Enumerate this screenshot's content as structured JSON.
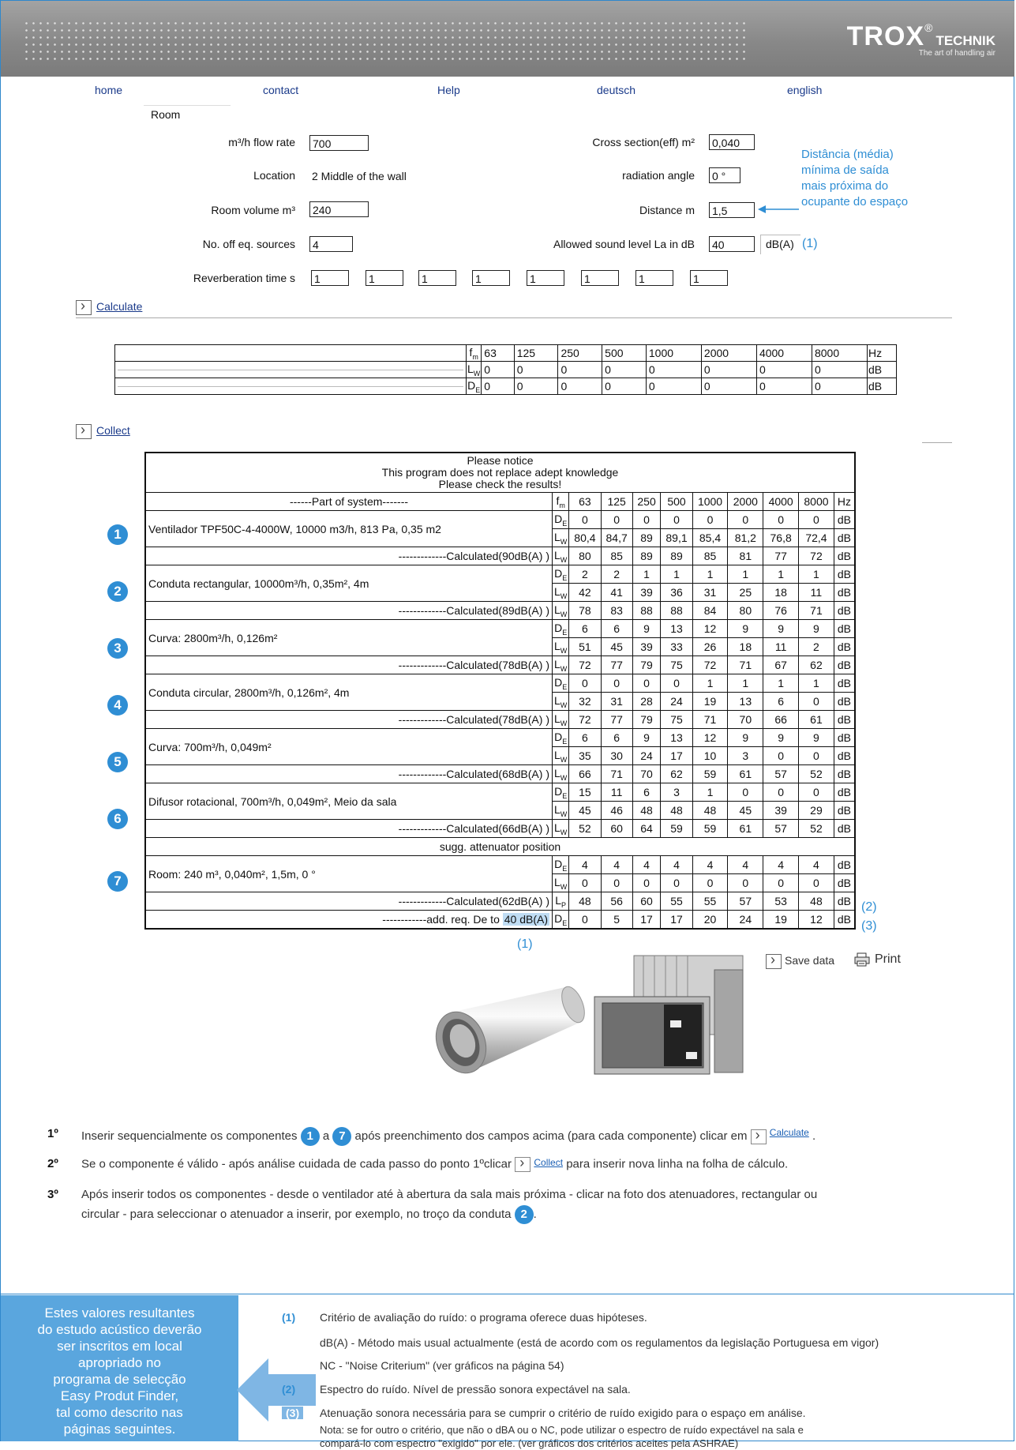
{
  "brand": {
    "logo_text": "TROX",
    "logo_suffix": "TECHNIK",
    "tagline": "The art of handling air"
  },
  "nav": [
    "home",
    "contact",
    "Help",
    "deutsch",
    "english"
  ],
  "room_label": "Room",
  "form": {
    "flow_label": "m³/h flow rate",
    "flow_value": "700",
    "location_label": "Location",
    "location_value": "2 Middle of the wall",
    "volume_label": "Room volume m³",
    "volume_value": "240",
    "sources_label": "No. off eq. sources",
    "sources_value": "4",
    "reverb_label": "Reverberation time s",
    "reverb_values": [
      "1",
      "1",
      "1",
      "1",
      "1",
      "1",
      "1",
      "1"
    ],
    "cross_label": "Cross section(eff) m²",
    "cross_value": "0,040",
    "angle_label": "radiation angle",
    "angle_value": "0 °",
    "distance_label": "Distance m",
    "distance_value": "1,5",
    "allowed_label": "Allowed sound level La in dB",
    "allowed_value": "40",
    "allowed_unit": "dB(A)",
    "allowed_ref": "(1)"
  },
  "distance_note": [
    "Distância (média)",
    "mínima de saída",
    "mais próxima do",
    "ocupante do espaço"
  ],
  "calculate_label": "Calculate",
  "collect_label": "Collect",
  "top_table": {
    "freqs": [
      "63",
      "125",
      "250",
      "500",
      "1000",
      "2000",
      "4000",
      "8000"
    ],
    "hz": "Hz",
    "fm": "fm",
    "lw": "LW",
    "de": "DE",
    "lw_values": [
      "0",
      "0",
      "0",
      "0",
      "0",
      "0",
      "0",
      "0"
    ],
    "de_values": [
      "0",
      "0",
      "0",
      "0",
      "0",
      "0",
      "0",
      "0"
    ],
    "unit": "dB"
  },
  "main_table": {
    "notice": [
      "Please notice",
      "This program does not replace adept knowledge",
      "Please check the results!"
    ],
    "part_header": "------Part of system-------",
    "fm": "fm",
    "freqs": [
      "63",
      "125",
      "250",
      "500",
      "1000",
      "2000",
      "4000",
      "8000"
    ],
    "hz": "Hz",
    "components": [
      {
        "num": "1",
        "name": "Ventilador TPF50C-4-4000W, 10000 m3/h, 813 Pa, 0,35 m2",
        "de": [
          "0",
          "0",
          "0",
          "0",
          "0",
          "0",
          "0",
          "0"
        ],
        "lw": [
          "80,4",
          "84,7",
          "89",
          "89,1",
          "85,4",
          "81,2",
          "76,8",
          "72,4"
        ],
        "calc": "-------------Calculated(90dB(A) )",
        "calc_vals": [
          "80",
          "85",
          "89",
          "89",
          "85",
          "81",
          "77",
          "72"
        ]
      },
      {
        "num": "2",
        "name": "Conduta rectangular, 10000m³/h, 0,35m², 4m",
        "de": [
          "2",
          "2",
          "1",
          "1",
          "1",
          "1",
          "1",
          "1"
        ],
        "lw": [
          "42",
          "41",
          "39",
          "36",
          "31",
          "25",
          "18",
          "11"
        ],
        "calc": "-------------Calculated(89dB(A) )",
        "calc_vals": [
          "78",
          "83",
          "88",
          "88",
          "84",
          "80",
          "76",
          "71"
        ]
      },
      {
        "num": "3",
        "name": "Curva: 2800m³/h, 0,126m²",
        "de": [
          "6",
          "6",
          "9",
          "13",
          "12",
          "9",
          "9",
          "9"
        ],
        "lw": [
          "51",
          "45",
          "39",
          "33",
          "26",
          "18",
          "11",
          "2"
        ],
        "calc": "-------------Calculated(78dB(A) )",
        "calc_vals": [
          "72",
          "77",
          "79",
          "75",
          "72",
          "71",
          "67",
          "62"
        ]
      },
      {
        "num": "4",
        "name": "Conduta circular, 2800m³/h, 0,126m², 4m",
        "de": [
          "0",
          "0",
          "0",
          "0",
          "1",
          "1",
          "1",
          "1"
        ],
        "lw": [
          "32",
          "31",
          "28",
          "24",
          "19",
          "13",
          "6",
          "0"
        ],
        "calc": "-------------Calculated(78dB(A) )",
        "calc_vals": [
          "72",
          "77",
          "79",
          "75",
          "71",
          "70",
          "66",
          "61"
        ]
      },
      {
        "num": "5",
        "name": "Curva: 700m³/h, 0,049m²",
        "de": [
          "6",
          "6",
          "9",
          "13",
          "12",
          "9",
          "9",
          "9"
        ],
        "lw": [
          "35",
          "30",
          "24",
          "17",
          "10",
          "3",
          "0",
          "0"
        ],
        "calc": "-------------Calculated(68dB(A) )",
        "calc_vals": [
          "66",
          "71",
          "70",
          "62",
          "59",
          "61",
          "57",
          "52"
        ]
      },
      {
        "num": "6",
        "name": "Difusor rotacional, 700m³/h, 0,049m², Meio da sala",
        "de": [
          "15",
          "11",
          "6",
          "3",
          "1",
          "0",
          "0",
          "0"
        ],
        "lw": [
          "45",
          "46",
          "48",
          "48",
          "48",
          "45",
          "39",
          "29"
        ],
        "calc": "-------------Calculated(66dB(A) )",
        "calc_vals": [
          "52",
          "60",
          "64",
          "59",
          "59",
          "61",
          "57",
          "52"
        ]
      }
    ],
    "sugg": "sugg. attenuator position",
    "room": {
      "num": "7",
      "name": "Room: 240 m³, 0,040m², 1,5m, 0 °",
      "de": [
        "4",
        "4",
        "4",
        "4",
        "4",
        "4",
        "4",
        "4"
      ],
      "lw": [
        "0",
        "0",
        "0",
        "0",
        "0",
        "0",
        "0",
        "0"
      ]
    },
    "final_calc": "-------------Calculated(62dB(A) )",
    "lp": "LP",
    "final_vals": [
      "48",
      "56",
      "60",
      "55",
      "55",
      "57",
      "53",
      "48"
    ],
    "final_ref": "(2)",
    "add_label": "------------add. req. De to",
    "add_hl": "40 dB(A)",
    "add_vals": [
      "0",
      "5",
      "17",
      "17",
      "20",
      "24",
      "19",
      "12"
    ],
    "add_ref": "(3)",
    "below_ref": "(1)",
    "unit": "dB",
    "de_sym": "DE",
    "lw_sym": "LW"
  },
  "save_label": "Save data",
  "print_label": "Print",
  "steps": [
    {
      "n": "1º",
      "a": "Inserir sequencialmente os componentes",
      "b": "a",
      "c": "após preenchimento dos campos acima (para cada componente) clicar em",
      "d": "Calculate",
      "e": "."
    },
    {
      "n": "2º",
      "a": "Se o componente é válido  - após análise cuidada de cada passo do ponto 1ºclicar",
      "d": "Collect",
      "e": "para inserir nova linha na folha de cálculo."
    },
    {
      "n": "3º",
      "a": "Após inserir todos os componentes - desde o ventilador até à abertura da sala mais próxima - clicar na foto dos atenuadores, rectangular ou",
      "b": "circular - para seleccionar o atenuador a inserir, por exemplo, no troço da conduta",
      "e": "."
    }
  ],
  "blue_box": [
    "Estes valores resultantes",
    "do estudo acústico deverão",
    "ser inscritos em local",
    "apropriado no",
    "programa de selecção",
    "Easy Produt Finder,",
    "tal como descrito nas",
    "páginas seguintes."
  ],
  "notes": [
    {
      "k": "(1)",
      "t": "Critério de avaliação do ruído: o programa oferece duas hipóteses."
    },
    {
      "k": "",
      "t": "dB(A) - Método mais usual actualmente (está de acordo com os regulamentos da legislação Portuguesa em vigor)"
    },
    {
      "k": "",
      "t": "NC - \"Noise Criterium\" (ver gráficos na página 54)"
    },
    {
      "k": "(2)",
      "t": "Espectro do ruído. Nível de pressão sonora expectável na sala."
    },
    {
      "k": "(3)",
      "t": "Atenuação sonora necessária para se cumprir o critério de ruído exigido para o espaço em análise."
    },
    {
      "k": "",
      "t": "Nota: se for outro o critério, que não o dBA ou o NC, pode utilizar o espectro de ruído expectável na sala e"
    },
    {
      "k": "",
      "t": "compará-lo com espectro \"exigido\" por ele. (ver gráficos dos critérios aceites pela ASHRAE)"
    }
  ]
}
